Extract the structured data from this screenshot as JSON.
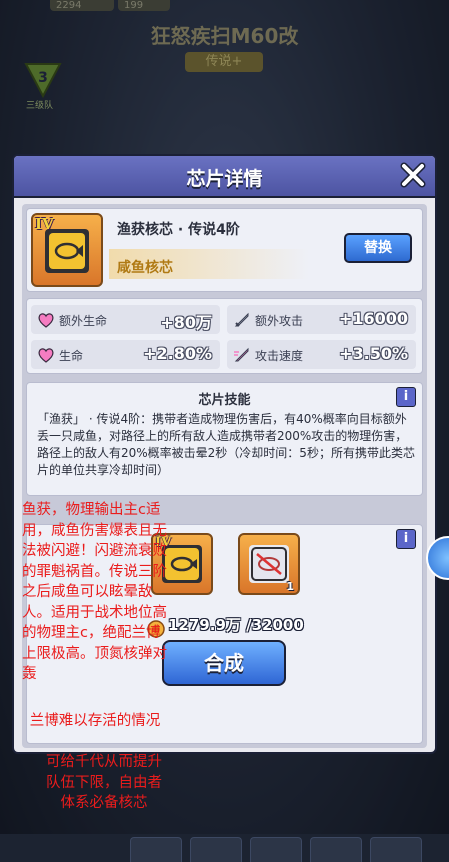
{
  "background": {
    "title": "狂怒疾扫M60改",
    "tag": "传说+",
    "stat_left": "2294",
    "stat_right": "199",
    "rank_number": "3",
    "rank_label": "三级队"
  },
  "dialog": {
    "title": "芯片详情",
    "close_icon": "close-icon",
    "chip": {
      "tier": "IV",
      "name": "渔获核芯 · 传说4阶",
      "class": "咸鱼核芯",
      "replace_label": "替换"
    },
    "stats": [
      {
        "label": "额外生命",
        "value": "+80万",
        "icon": "heart-icon"
      },
      {
        "label": "额外攻击",
        "value": "+16000",
        "icon": "sword-icon"
      },
      {
        "label": "生命",
        "value": "+2.80%",
        "icon": "heart-icon"
      },
      {
        "label": "攻击速度",
        "value": "+3.50%",
        "icon": "sword-speed-icon"
      }
    ],
    "skill": {
      "title": "芯片技能",
      "info": "i",
      "text": "「渔获」 · 传说4阶：携带者造成物理伤害后，有40%概率向目标额外丢一只咸鱼，对路径上的所有敌人造成携带者200%攻击的物理伤害，路径上的敌人有20%概率被击晕2秒（冷却时间：5秒；所有携带此类芯片的单位共享冷却时间）"
    },
    "synthesis": {
      "info": "i",
      "material_tier": "IV",
      "material_count": "1",
      "cost": "1279.9万 /32000",
      "button_label": "合成"
    }
  },
  "annotation": {
    "line1": "鱼获，物理输出主c适用，咸鱼伤害爆表且无法被闪避！闪避流衰败的罪魁祸首。传说三阶之后咸鱼可以眩晕敌人。适用于战术地位高的物理主c，绝配兰博上限极高。顶氮核弹对轰",
    "line2": "兰博难以存活的情况",
    "line3": "可给千代从而提升队伍下限，自由者体系必备核芯"
  },
  "colors": {
    "header": "#5a61b0",
    "accent_button": "#3f7ee6",
    "annotation": "#ea1c1c",
    "chip_orange": "#e8923a"
  }
}
